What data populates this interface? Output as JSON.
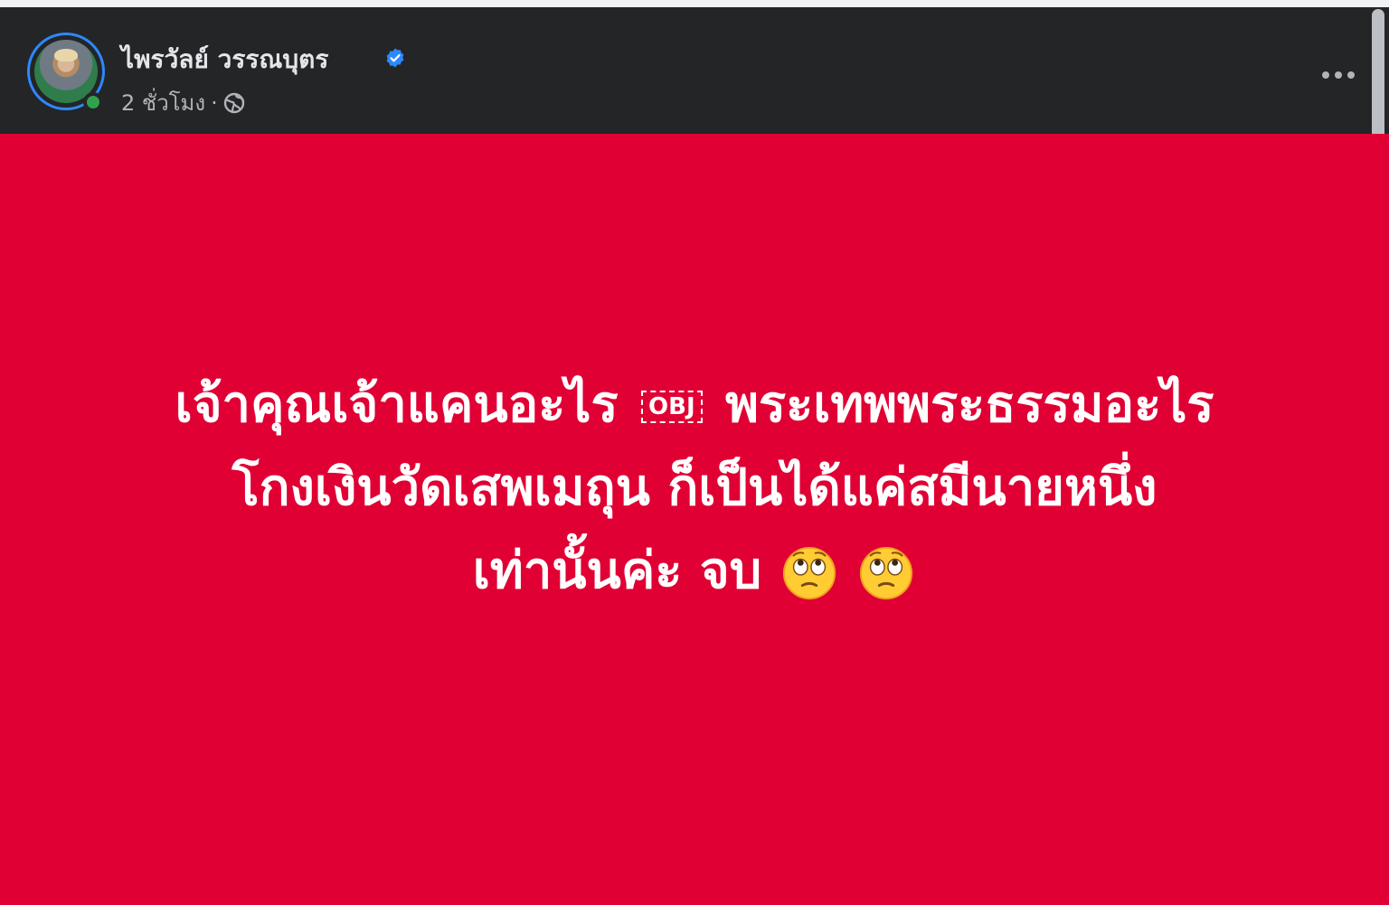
{
  "post": {
    "author_name": "ไพรวัลย์ วรรณบุตร",
    "timestamp": "2 ชั่วโมง",
    "separator": "·",
    "privacy_icon": "globe-icon",
    "verified_icon": "verified-badge-icon",
    "more_icon": "more-options-icon"
  },
  "status": {
    "background_color": "#e00034",
    "line1_before": "เจ้าคุณเจ้าแคนอะไร",
    "object_placeholder": "OBJ",
    "line1_after": "พระเทพพระธรรมอะไร",
    "line2": "โกงเงินวัดเสพเมถุน ก็เป็นได้แค่สมีนายหนึ่ง",
    "line3": "เท่านั้นค่ะ จบ",
    "emojis": [
      "face-with-rolling-eyes-icon",
      "face-with-rolling-eyes-icon"
    ]
  },
  "colors": {
    "header_bg": "#242526",
    "accent_blue": "#2d88ff",
    "online_green": "#31a24c"
  }
}
